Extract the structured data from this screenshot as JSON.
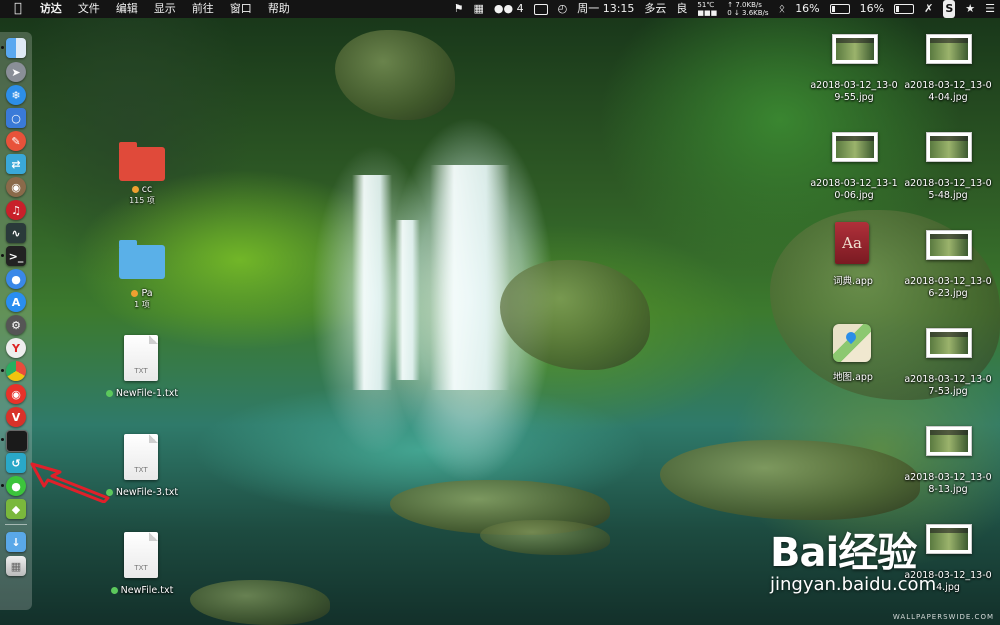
{
  "menubar": {
    "apple": "",
    "app": "访达",
    "menus": [
      "文件",
      "编辑",
      "显示",
      "前往",
      "窗口",
      "帮助"
    ],
    "wechat_count": "4",
    "datetime": "周一 13:15",
    "weather": "多云",
    "air": "良",
    "cpu_temp": "51℃",
    "net_up": "↑ 7.0KB/s",
    "net_down": "0 ↓ 3.6KB/s",
    "battery1": "16%",
    "battery2": "16%"
  },
  "dock": {
    "icons": [
      "finder",
      "launchpad",
      "safari",
      "preview",
      "pages",
      "migration",
      "photo",
      "netease-music",
      "activity-monitor",
      "terminal",
      "siri",
      "app-store",
      "system-preferences",
      "yandex",
      "chrome",
      "weibo",
      "vivaldi",
      "terminal-2",
      "teamviewer",
      "wechat",
      "android",
      "downloads",
      "trash"
    ]
  },
  "desktop": {
    "folders": [
      {
        "name": "cc",
        "sub": "115 项",
        "color": "#e04a3a",
        "tag": "#f0a030"
      },
      {
        "name": "Pa",
        "sub": "1 项",
        "color": "#5ab0e8",
        "tag": "#f0a030"
      }
    ],
    "files": [
      {
        "name": "NewFile-1.txt",
        "kind": "TXT",
        "tag": "#5cc85c"
      },
      {
        "name": "NewFile-3.txt",
        "kind": "TXT",
        "tag": "#5cc85c"
      },
      {
        "name": "NewFile.txt",
        "kind": "TXT",
        "tag": "#5cc85c"
      }
    ],
    "images": [
      {
        "line1": "a2018-03-12_13-0",
        "line2": "9-55.jpg"
      },
      {
        "line1": "a2018-03-12_13-0",
        "line2": "4-04.jpg"
      },
      {
        "line1": "a2018-03-12_13-1",
        "line2": "0-06.jpg"
      },
      {
        "line1": "a2018-03-12_13-0",
        "line2": "5-48.jpg"
      },
      {
        "line1": "a2018-03-12_13-0",
        "line2": "6-23.jpg"
      },
      {
        "line1": "a2018-03-12_13-0",
        "line2": "7-53.jpg"
      },
      {
        "line1": "a2018-03-12_13-0",
        "line2": "8-13.jpg"
      },
      {
        "line1": "a2018-03-12_13-0",
        "line2": "4.jpg"
      }
    ],
    "apps": [
      {
        "name": "词典.app",
        "glyph": "Aa"
      },
      {
        "name": "地图.app"
      }
    ]
  },
  "watermark": {
    "text": "Bai经验",
    "url": "jingyan.baidu.com",
    "credit": "WALLPAPERSWIDE.COM"
  }
}
